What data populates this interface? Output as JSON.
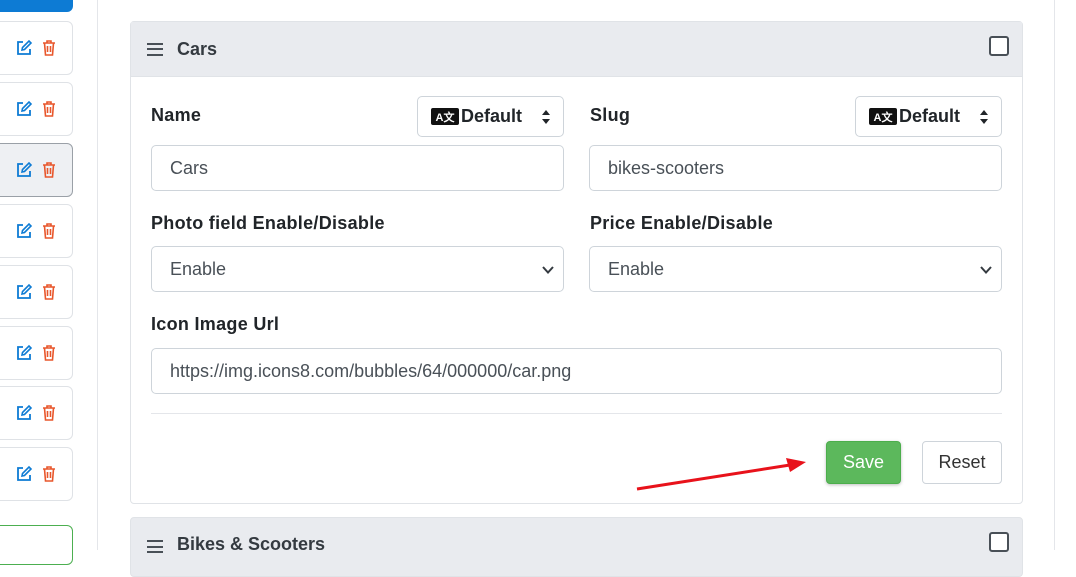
{
  "left_rows": [
    {
      "active": false
    },
    {
      "active": false
    },
    {
      "active": true
    },
    {
      "active": false
    },
    {
      "active": false
    },
    {
      "active": false
    },
    {
      "active": false
    },
    {
      "active": false
    }
  ],
  "icons": {
    "edit": "edit-icon",
    "delete": "trash-icon",
    "drag": "hamburger-icon",
    "translate": "translate-icon"
  },
  "colors": {
    "edit": "#0d7bd4",
    "delete": "#e8572c",
    "save": "#5cb85c",
    "arrow": "#e8121b"
  },
  "card": {
    "title": "Cars",
    "name_label": "Name",
    "name_lang": "Default",
    "name_value": "Cars",
    "slug_label": "Slug",
    "slug_lang": "Default",
    "slug_value": "bikes-scooters",
    "photo_label": "Photo field Enable/Disable",
    "photo_value": "Enable",
    "price_label": "Price Enable/Disable",
    "price_value": "Enable",
    "icon_label": "Icon Image Url",
    "icon_value": "https://img.icons8.com/bubbles/64/000000/car.png",
    "save_label": "Save",
    "reset_label": "Reset"
  },
  "card2": {
    "title": "Bikes & Scooters"
  }
}
